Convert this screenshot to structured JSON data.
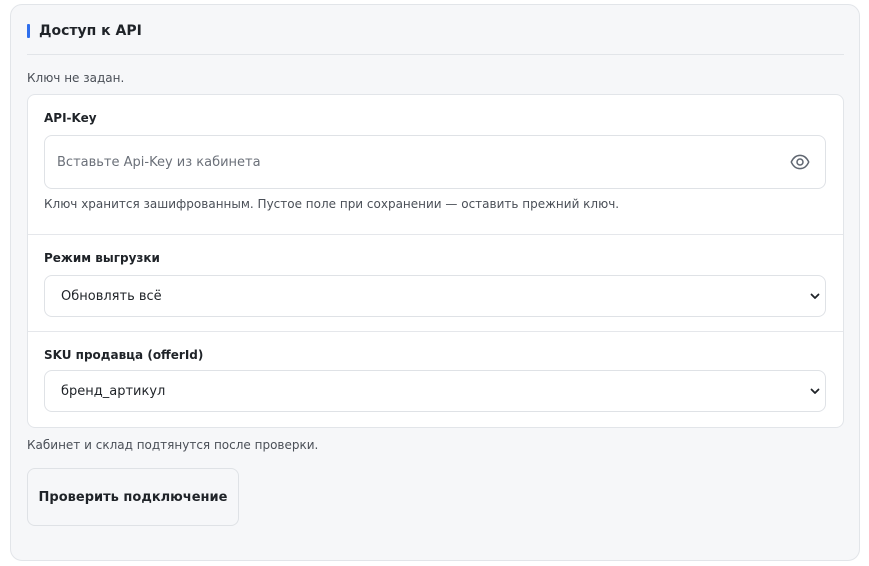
{
  "section": {
    "title": "Доступ к API",
    "accent_color": "#2f6fed",
    "status": "Ключ не задан."
  },
  "api_key": {
    "label": "API-Key",
    "value": "",
    "placeholder": "Вставьте Api-Key из кабинета",
    "toggle_icon": "eye-icon",
    "hint": "Ключ хранится зашифрованным. Пустое поле при сохранении — оставить прежний ключ."
  },
  "export_mode": {
    "label": "Режим выгрузки",
    "selected": "Обновлять всё",
    "icon": "chevron-down-icon"
  },
  "seller_sku": {
    "label": "SKU продавца (offerId)",
    "selected": "бренд_артикул",
    "icon": "chevron-down-icon"
  },
  "footer": {
    "note": "Кабинет и склад подтянутся после проверки.",
    "check_button": "Проверить подключение"
  }
}
